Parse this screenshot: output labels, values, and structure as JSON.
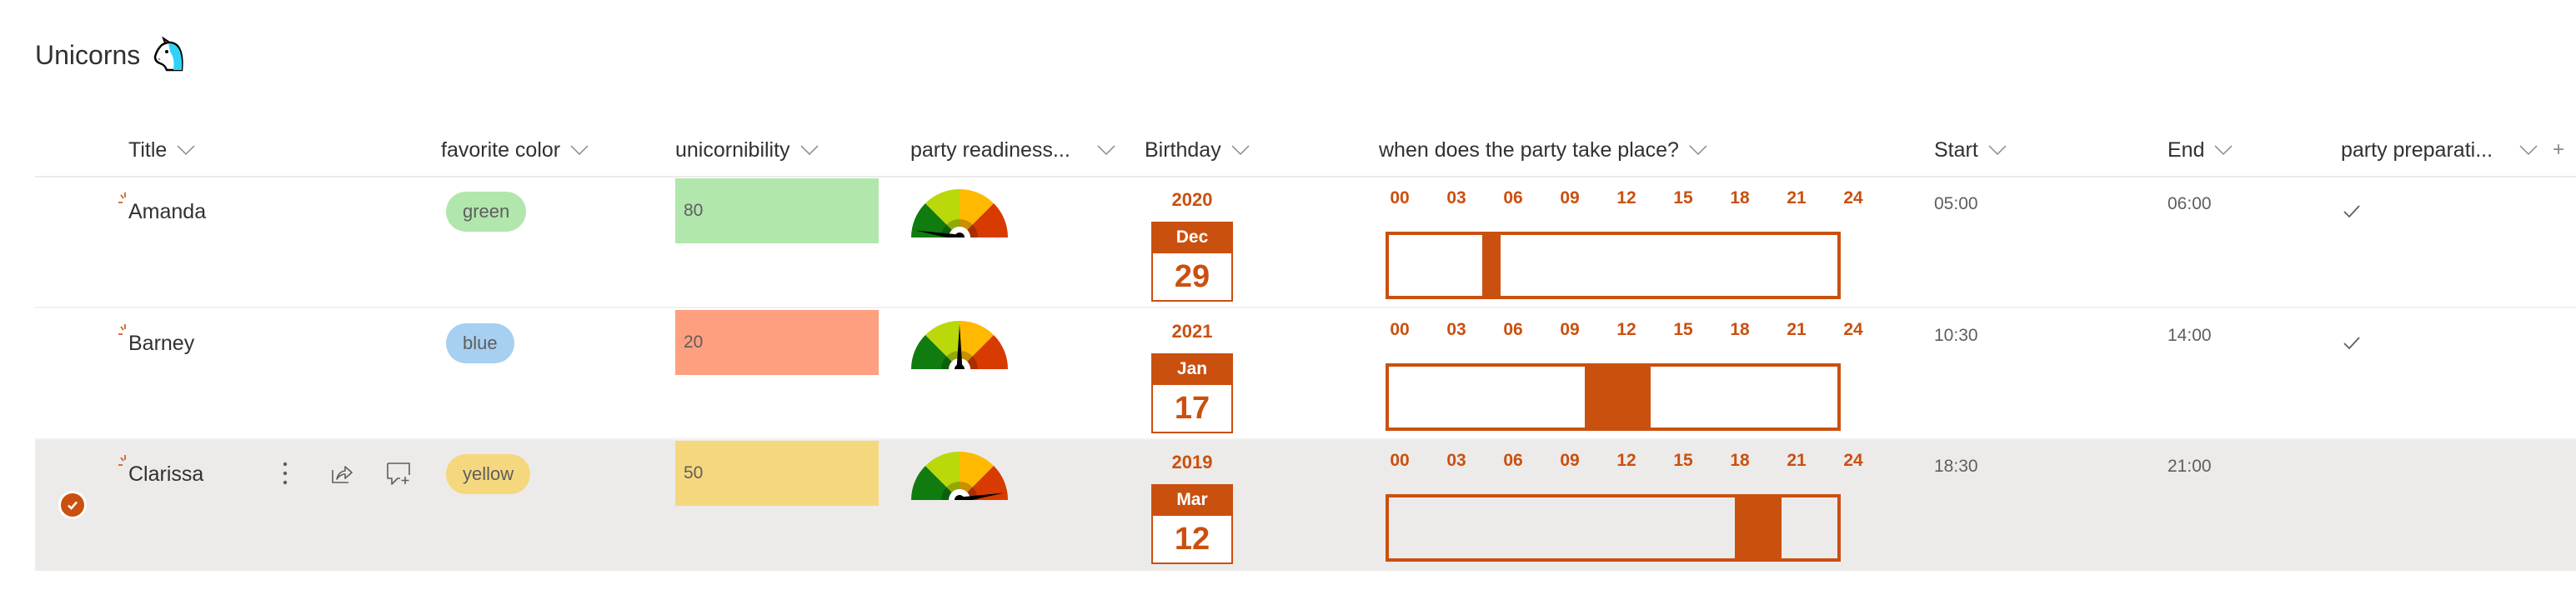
{
  "page": {
    "title": "Unicorns",
    "title_icon": "unicorn-icon"
  },
  "columns": [
    {
      "key": "title",
      "label": "Title"
    },
    {
      "key": "favorite_color",
      "label": "favorite color"
    },
    {
      "key": "unicornibility",
      "label": "unicornibility"
    },
    {
      "key": "party_readiness",
      "label": "party readiness..."
    },
    {
      "key": "birthday",
      "label": "Birthday"
    },
    {
      "key": "party_time",
      "label": "when does the party take place?"
    },
    {
      "key": "start",
      "label": "Start"
    },
    {
      "key": "end",
      "label": "End"
    },
    {
      "key": "party_preparation",
      "label": "party preparati..."
    }
  ],
  "colors": {
    "accent": "#ca5010",
    "selected_row_bg": "#edebe9",
    "pill_green": "#b1e6ad",
    "pill_blue": "#a7cff0",
    "pill_yellow": "#f5d77e",
    "uni_green": "#b1e6ad",
    "uni_salmon": "#fe9f80",
    "uni_yellow": "#f5d77e",
    "gauge_segments": [
      "#107c10",
      "#bad80a",
      "#ffb900",
      "#d83b01"
    ]
  },
  "timeline_ticks": [
    "00",
    "03",
    "06",
    "09",
    "12",
    "15",
    "18",
    "21",
    "24"
  ],
  "row_actions": [
    {
      "name": "more-options",
      "icon": "more-vertical-icon"
    },
    {
      "name": "share",
      "icon": "share-icon"
    },
    {
      "name": "add-comment",
      "icon": "comment-add-icon"
    }
  ],
  "rows": [
    {
      "title": "Amanda",
      "is_new": true,
      "selected": false,
      "favorite_color": "green",
      "favorite_color_bg": "#b1e6ad",
      "unicornibility": "80",
      "unicornibility_bg": "#b1e6ad",
      "party_readiness_fraction": 0.05,
      "birthday": {
        "year": "2020",
        "month": "Dec",
        "day": "29"
      },
      "party_start_hours": 5.0,
      "party_end_hours": 6.0,
      "start": "05:00",
      "end": "06:00",
      "party_preparation_done": true
    },
    {
      "title": "Barney",
      "is_new": true,
      "selected": false,
      "favorite_color": "blue",
      "favorite_color_bg": "#a7cff0",
      "unicornibility": "20",
      "unicornibility_bg": "#fe9f80",
      "party_readiness_fraction": 0.5,
      "birthday": {
        "year": "2021",
        "month": "Jan",
        "day": "17"
      },
      "party_start_hours": 10.5,
      "party_end_hours": 14.0,
      "start": "10:30",
      "end": "14:00",
      "party_preparation_done": true
    },
    {
      "title": "Clarissa",
      "is_new": true,
      "selected": true,
      "favorite_color": "yellow",
      "favorite_color_bg": "#f5d77e",
      "unicornibility": "50",
      "unicornibility_bg": "#f5d77e",
      "party_readiness_fraction": 0.95,
      "birthday": {
        "year": "2019",
        "month": "Mar",
        "day": "12"
      },
      "party_start_hours": 18.5,
      "party_end_hours": 21.0,
      "start": "18:30",
      "end": "21:00",
      "party_preparation_done": false
    }
  ]
}
